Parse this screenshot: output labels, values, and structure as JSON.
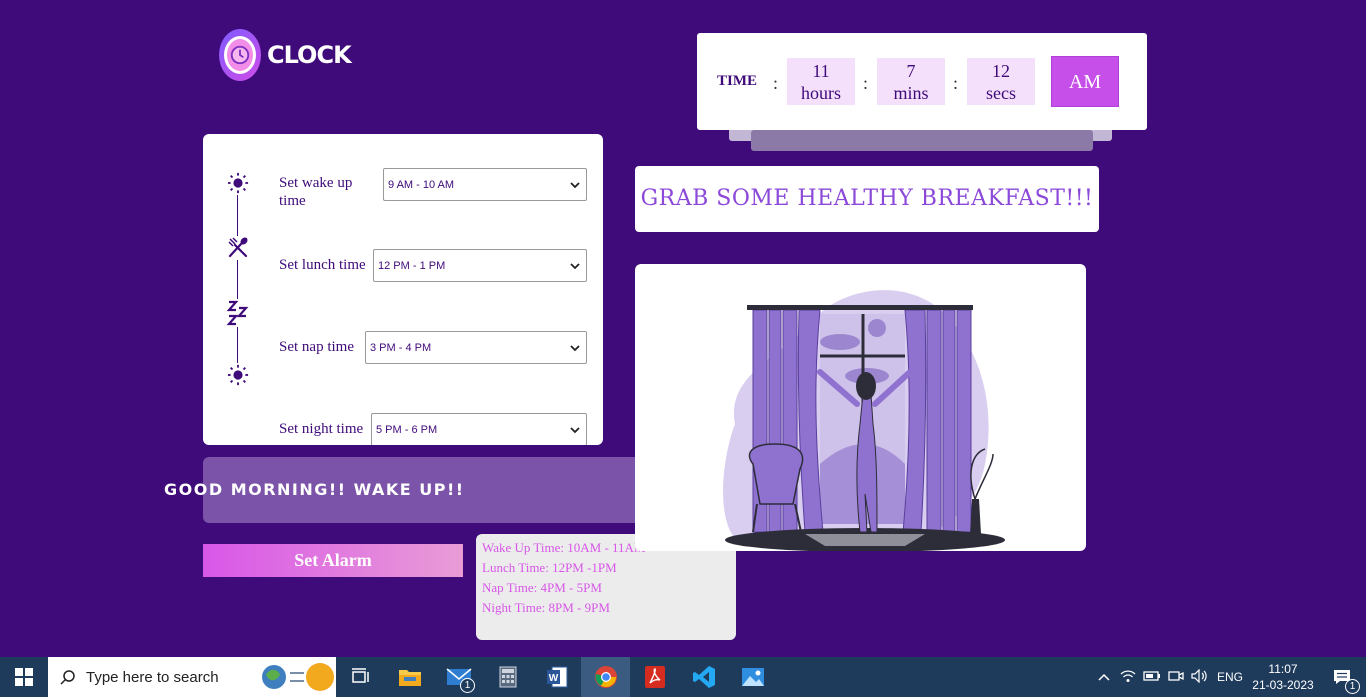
{
  "app": {
    "logo_text": "CLOCK"
  },
  "time_display": {
    "label": "TIME",
    "separator": ":",
    "hours_value": "11",
    "hours_unit": "hours",
    "mins_value": "7",
    "mins_unit": "mins",
    "secs_value": "12",
    "secs_unit": "secs",
    "period": "AM"
  },
  "settings": {
    "wake": {
      "label": "Set wake up time",
      "selected": "9 AM - 10 AM"
    },
    "lunch": {
      "label": "Set lunch time",
      "selected": "12 PM - 1 PM"
    },
    "nap": {
      "label": "Set nap time",
      "selected": "3 PM - 4 PM"
    },
    "night": {
      "label": "Set night time",
      "selected": "5 PM - 6 PM"
    }
  },
  "greeting": "GOOD MORNING!! WAKE UP!!",
  "set_alarm_label": "Set Alarm",
  "schedule": {
    "wake": "Wake Up Time: 10AM - 11AM",
    "lunch": "Lunch Time: 12PM -1PM",
    "nap": "Nap Time: 4PM - 5PM",
    "night": "Night Time: 8PM - 9PM"
  },
  "message": "GRAB SOME HEALTHY BREAKFAST!!!",
  "taskbar": {
    "search_placeholder": "Type here to search",
    "mail_badge": "1",
    "language": "ENG",
    "time": "11:07",
    "date": "21-03-2023",
    "notification_badge": "1"
  },
  "colors": {
    "background": "#3f0a7a",
    "accent": "#c54fe8",
    "message_text": "#8b48d9",
    "schedule_text": "#d857e8"
  }
}
